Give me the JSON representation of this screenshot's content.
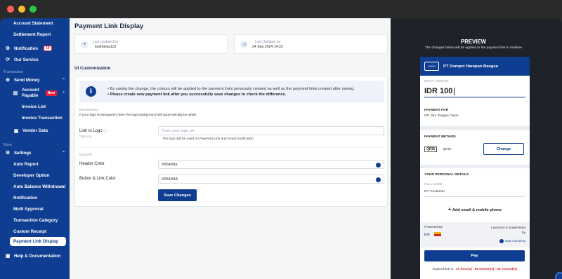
{
  "window": {
    "dots": [
      "#ff5f57",
      "#febc2e",
      "#28c840"
    ]
  },
  "colors": {
    "brand": "#0e3d91",
    "danger": "#d8232a"
  },
  "sidebar": {
    "top_items": [
      {
        "label": "Account Statement"
      },
      {
        "label": "Settlement Report"
      }
    ],
    "notification": {
      "label": "Notification",
      "count": "10",
      "icon": "gear-icon"
    },
    "our_service": {
      "label": "Our Service",
      "icon": "refresh-icon"
    },
    "transaction_section": "Transaction",
    "send_money": {
      "label": "Send Money",
      "icon": "send-icon"
    },
    "account_payable": {
      "label_line1": "Account",
      "label_line2": "Payable",
      "badge": "New",
      "icon": "document-icon"
    },
    "ap_children": [
      {
        "label": "Invoice List"
      },
      {
        "label": "Invoice Transaction"
      }
    ],
    "vendor_data": {
      "label": "Vendor Data",
      "icon": "vendor-icon"
    },
    "more_section": "More",
    "settings": {
      "label": "Settings",
      "icon": "gear-icon"
    },
    "settings_children": [
      {
        "label": "Auto Report"
      },
      {
        "label": "Developer Option"
      },
      {
        "label": "Auto Balance Withdrawal"
      },
      {
        "label": "Notification"
      },
      {
        "label": "Multi Approval"
      },
      {
        "label": "Transaction Category"
      },
      {
        "label": "Custom Receipt"
      }
    ],
    "active_item": "Payment Link Display",
    "help": {
      "label": "Help & Documentation",
      "icon": "help-icon"
    }
  },
  "main": {
    "title": "Payment Link Display",
    "updated_by": {
      "label": "Last Updated by",
      "value": "andinieka122"
    },
    "updated_on": {
      "label": "Last Updated on",
      "value": "24 Sep 2024 14:22"
    },
    "section_title": "UI Customization",
    "alert": {
      "line1": "By saving the change, the colours will be applied to the payment links previously created as well as the payment links created after saving.",
      "line2": "Please create new payment link after you successfully save changes to check the difference."
    },
    "branding": {
      "title": "BRANDING",
      "hint": "If your logo is transparent then the logo background will automatically be white.",
      "logo_label": "Link to Logo",
      "logo_optional": "Optional",
      "logo_placeholder": "Type your logo url",
      "logo_note": "The logo will be used on Payment Link and Email Notification"
    },
    "color": {
      "title": "COLOR",
      "header_label": "Header Color",
      "header_value": "#06499a",
      "button_label": "Button & Link Color",
      "button_value": "#06499A"
    },
    "save_label": "Save Changes"
  },
  "preview": {
    "title": "PREVIEW",
    "subtitle": "The changes below will be applied to the payment link in realtime",
    "merchant": "PT Dompet Harapan Bangsa",
    "logo_text": "LOGO",
    "input_amount_label": "INPUT AMOUNT",
    "amount": "IDR 100",
    "payment_for_label": "PAYMENT FOR",
    "payment_for_value": "DP Jam Tangan Casio",
    "payment_method_label": "PAYMENT METHOD",
    "method": "QRIS",
    "method_logo": "QRIS",
    "change_label": "Change",
    "personal_label": "YOUR PERSONAL DETAILS",
    "full_name_label": "FULL NAME",
    "full_name_value": "DY Customer",
    "add_contact": "Add email & mobile phone",
    "powered_by": "Powered By",
    "powered_logo": "DYI",
    "licensed_line1": "Licensed & Supervised",
    "licensed_line2": "by",
    "bi_text": "BANK INDONESIA",
    "pay_label": "Pay",
    "expired_prefix": "Expired link in :",
    "expired_hours": "21 hour(s)",
    "expired_sep1": ":",
    "expired_minutes": "56 minute(s)",
    "expired_sep2": ":",
    "expired_seconds": "28 second(s)"
  }
}
